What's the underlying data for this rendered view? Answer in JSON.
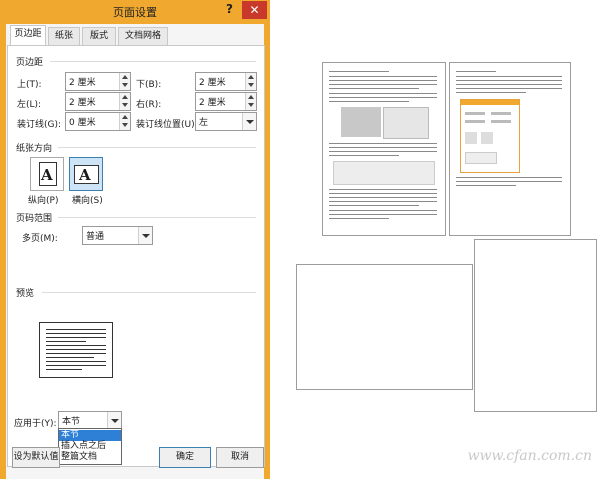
{
  "dialog": {
    "title": "页面设置",
    "help": "?",
    "close": "✕",
    "tabs": [
      "页边距",
      "纸张",
      "版式",
      "文档网格"
    ],
    "margins": {
      "section": "页边距",
      "top_label": "上(T):",
      "top": "2 厘米",
      "bottom_label": "下(B):",
      "bottom": "2 厘米",
      "left_label": "左(L):",
      "left": "2 厘米",
      "right_label": "右(R):",
      "right": "2 厘米",
      "gutter_label": "装订线(G):",
      "gutter": "0 厘米",
      "gutter_pos_label": "装订线位置(U):",
      "gutter_pos": "左"
    },
    "orientation": {
      "section": "纸张方向",
      "portrait": "纵向(P)",
      "landscape": "横向(S)",
      "glyph": "A",
      "selected": "landscape"
    },
    "pages": {
      "section": "页码范围",
      "multi_label": "多页(M):",
      "multi_value": "普通"
    },
    "preview": {
      "section": "预览"
    },
    "apply": {
      "label": "应用于(Y):",
      "value": "本节",
      "options": [
        "本节",
        "插入点之后",
        "整篇文档"
      ],
      "highlighted": 0
    },
    "buttons": {
      "set_default": "设为默认值",
      "ok": "确定",
      "cancel": "取消"
    }
  },
  "watermark": "www.cfan.com.cn",
  "colors": {
    "title_bar": "#f0a92e",
    "close": "#c8392b",
    "highlight": "#2d80d6"
  }
}
